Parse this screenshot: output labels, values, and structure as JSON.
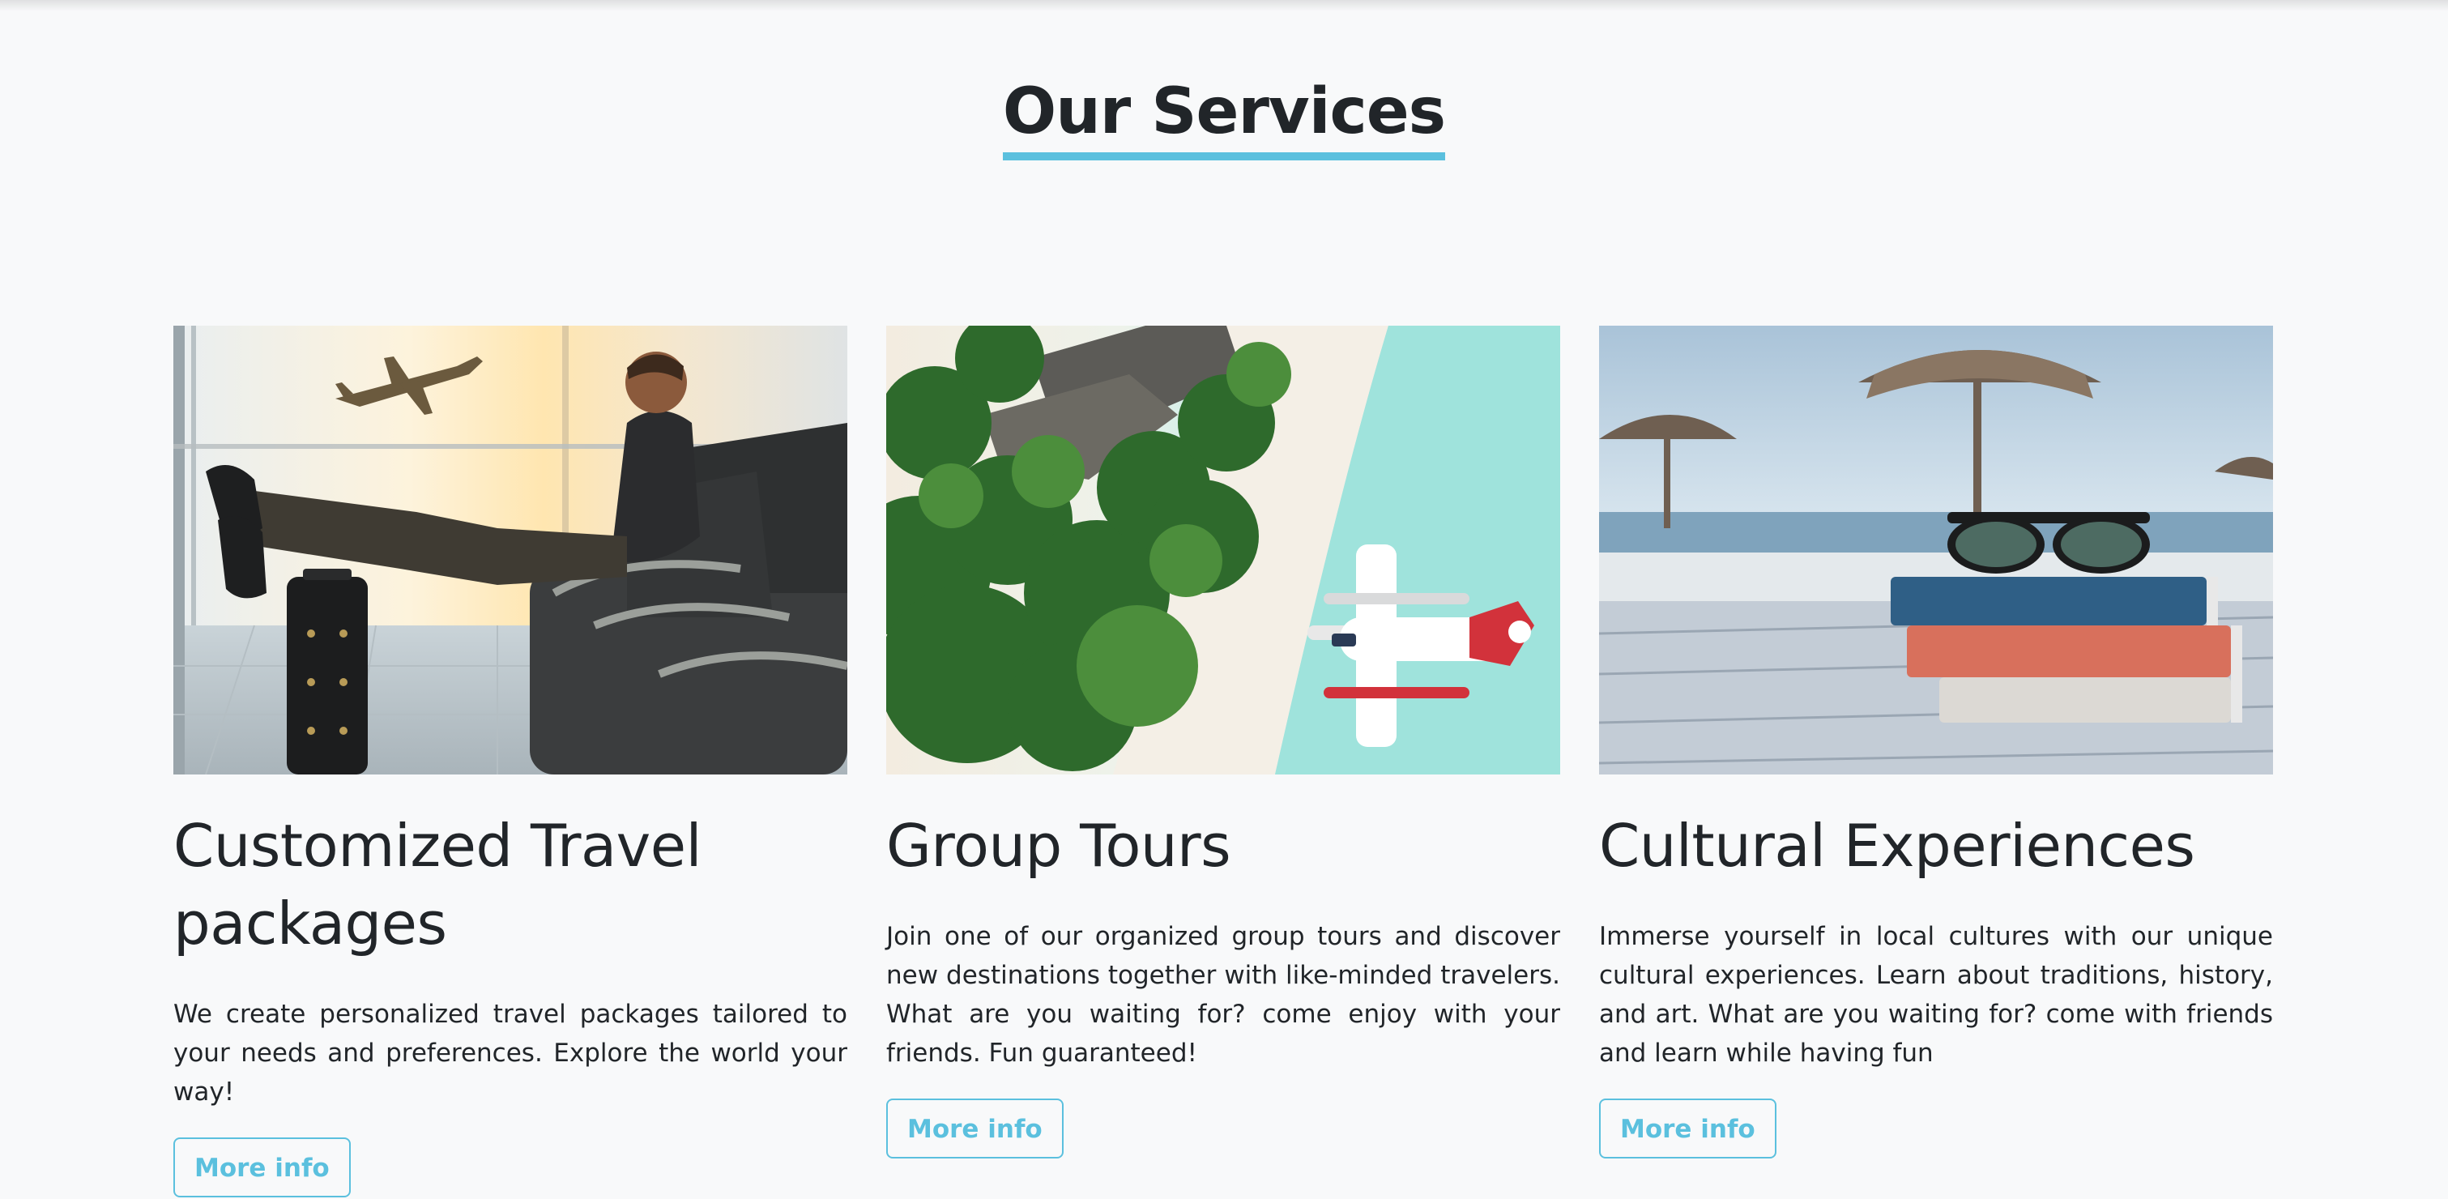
{
  "section": {
    "title": "Our Services"
  },
  "accent_color": "#5bc0de",
  "cards": [
    {
      "image": "traveler-at-airport-photo",
      "title": "Customized Travel packages",
      "text": "We create personalized travel packages tailored to your needs and preferences. Explore the world your way!",
      "button_label": "More info"
    },
    {
      "image": "aerial-seaplane-tropical-beach-photo",
      "title": "Group Tours",
      "text": "Join one of our organized group tours and discover new destinations together with like-minded travelers. What are you waiting for? come enjoy with your friends. Fun guaranteed!",
      "button_label": "More info"
    },
    {
      "image": "books-and-sunglasses-on-beach-photo",
      "title": "Cultural Experiences",
      "text": "Immerse yourself in local cultures with our unique cultural experiences. Learn about traditions, history, and art. What are you waiting for? come with friends and learn while having fun",
      "button_label": "More info"
    }
  ]
}
